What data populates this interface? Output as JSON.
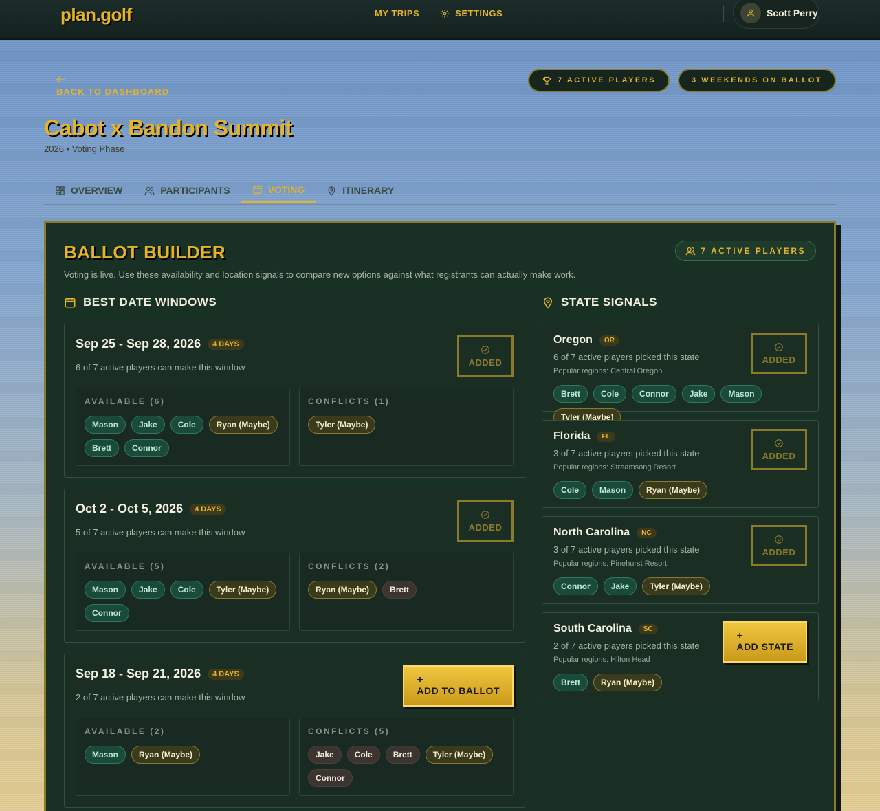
{
  "app": {
    "logo": "plan.golf",
    "nav": [
      {
        "label": "MY TRIPS",
        "icon": "none"
      },
      {
        "label": "SETTINGS",
        "icon": "gear-icon"
      }
    ],
    "user": {
      "name": "Scott Perry",
      "icon": "user-icon"
    }
  },
  "header": {
    "back_label": "BACK TO DASHBOARD",
    "title": "Cabot x Bandon Summit",
    "subtitle": "2026 • Voting Phase",
    "pills": [
      {
        "label": "7 ACTIVE PLAYERS",
        "icon": "trophy-icon"
      },
      {
        "label": "3 WEEKENDS ON BALLOT",
        "icon": "none"
      }
    ]
  },
  "tabs": [
    {
      "label": "OVERVIEW",
      "icon": "grid-icon",
      "active": false
    },
    {
      "label": "PARTICIPANTS",
      "icon": "users-icon",
      "active": false
    },
    {
      "label": "VOTING",
      "icon": "calendar-icon",
      "active": true
    },
    {
      "label": "ITINERARY",
      "icon": "map-pin-icon",
      "active": false
    }
  ],
  "panel": {
    "title": "BALLOT BUILDER",
    "description": "Voting is live. Use these availability and location signals to compare new options against what registrants can actually make work.",
    "pill": "7 ACTIVE PLAYERS",
    "dates_heading": "BEST DATE WINDOWS",
    "states_heading": "STATE SIGNALS"
  },
  "date_windows": [
    {
      "range": "Sep 25 - Sep 28, 2026",
      "days": "4 DAYS",
      "summary": "6 of 7 active players can make this window",
      "action": "ADDED",
      "added": true,
      "available_label": "AVAILABLE (6)",
      "available": [
        {
          "name": "Mason",
          "maybe": false
        },
        {
          "name": "Jake",
          "maybe": false
        },
        {
          "name": "Cole",
          "maybe": false
        },
        {
          "name": "Ryan (Maybe)",
          "maybe": true
        },
        {
          "name": "Brett",
          "maybe": false
        },
        {
          "name": "Connor",
          "maybe": false
        }
      ],
      "conflicts_label": "CONFLICTS (1)",
      "conflicts": [
        {
          "name": "Tyler (Maybe)",
          "maybe": true
        }
      ]
    },
    {
      "range": "Oct 2 - Oct 5, 2026",
      "days": "4 DAYS",
      "summary": "5 of 7 active players can make this window",
      "action": "ADDED",
      "added": true,
      "available_label": "AVAILABLE (5)",
      "available": [
        {
          "name": "Mason",
          "maybe": false
        },
        {
          "name": "Jake",
          "maybe": false
        },
        {
          "name": "Cole",
          "maybe": false
        },
        {
          "name": "Tyler (Maybe)",
          "maybe": true
        },
        {
          "name": "Connor",
          "maybe": false
        }
      ],
      "conflicts_label": "CONFLICTS (2)",
      "conflicts": [
        {
          "name": "Ryan (Maybe)",
          "maybe": true
        },
        {
          "name": "Brett",
          "maybe": false
        }
      ]
    },
    {
      "range": "Sep 18 - Sep 21, 2026",
      "days": "4 DAYS",
      "summary": "2 of 7 active players can make this window",
      "action": "ADD TO BALLOT",
      "added": false,
      "available_label": "AVAILABLE (2)",
      "available": [
        {
          "name": "Mason",
          "maybe": false
        },
        {
          "name": "Ryan (Maybe)",
          "maybe": true
        }
      ],
      "conflicts_label": "CONFLICTS (5)",
      "conflicts": [
        {
          "name": "Jake",
          "maybe": false
        },
        {
          "name": "Cole",
          "maybe": false
        },
        {
          "name": "Brett",
          "maybe": false
        },
        {
          "name": "Tyler (Maybe)",
          "maybe": true
        },
        {
          "name": "Connor",
          "maybe": false
        }
      ]
    }
  ],
  "states": [
    {
      "name": "Oregon",
      "code": "OR",
      "summary": "6 of 7 active players picked this state",
      "regions": "Popular regions: Central Oregon",
      "action": "ADDED",
      "added": true,
      "players": [
        {
          "name": "Brett",
          "maybe": false
        },
        {
          "name": "Cole",
          "maybe": false
        },
        {
          "name": "Connor",
          "maybe": false
        },
        {
          "name": "Jake",
          "maybe": false
        },
        {
          "name": "Mason",
          "maybe": false
        },
        {
          "name": "Tyler (Maybe)",
          "maybe": true
        }
      ]
    },
    {
      "name": "Florida",
      "code": "FL",
      "summary": "3 of 7 active players picked this state",
      "regions": "Popular regions: Streamsong Resort",
      "action": "ADDED",
      "added": true,
      "players": [
        {
          "name": "Cole",
          "maybe": false
        },
        {
          "name": "Mason",
          "maybe": false
        },
        {
          "name": "Ryan (Maybe)",
          "maybe": true
        }
      ]
    },
    {
      "name": "North Carolina",
      "code": "NC",
      "summary": "3 of 7 active players picked this state",
      "regions": "Popular regions: Pinehurst Resort",
      "action": "ADDED",
      "added": true,
      "players": [
        {
          "name": "Connor",
          "maybe": false
        },
        {
          "name": "Jake",
          "maybe": false
        },
        {
          "name": "Tyler (Maybe)",
          "maybe": true
        }
      ]
    },
    {
      "name": "South Carolina",
      "code": "SC",
      "summary": "2 of 7 active players picked this state",
      "regions": "Popular regions: Hilton Head",
      "action": "ADD STATE",
      "added": false,
      "players": [
        {
          "name": "Brett",
          "maybe": false
        },
        {
          "name": "Ryan (Maybe)",
          "maybe": true
        }
      ]
    }
  ],
  "colors": {
    "accent": "#e3b42b",
    "panel": "#193024",
    "chip_available": "#1a4b3a",
    "chip_maybe": "#3a3a1c",
    "chip_conflict": "#3b3430"
  }
}
